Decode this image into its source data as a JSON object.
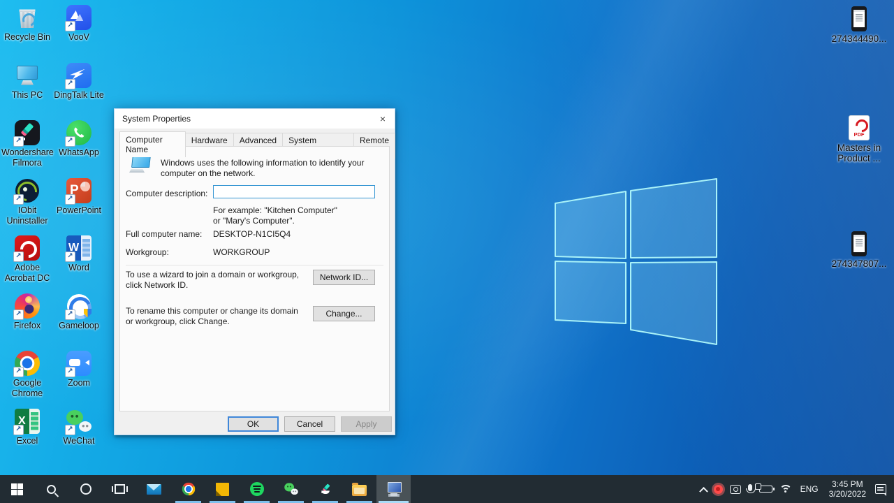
{
  "colors": {
    "wallpaper_left": "#1fbdf0",
    "wallpaper_right": "#0a50a5",
    "taskbar_bg": "#222c33",
    "running_indicator": "#7fc0ec",
    "focus_border": "#3f87d9"
  },
  "desktop": {
    "left_icons": [
      {
        "label": "Recycle Bin",
        "name": "recycle-bin"
      },
      {
        "label": "VooV",
        "name": "voov"
      },
      {
        "label": "This PC",
        "name": "this-pc"
      },
      {
        "label": "DingTalk Lite",
        "name": "dingtalk-lite"
      },
      {
        "label": "Wondershare Filmora",
        "name": "wondershare-filmora"
      },
      {
        "label": "WhatsApp",
        "name": "whatsapp"
      },
      {
        "label": "IObit Uninstaller",
        "name": "iobit-uninstaller"
      },
      {
        "label": "PowerPoint",
        "name": "powerpoint"
      },
      {
        "label": "Adobe Acrobat DC",
        "name": "adobe-acrobat-dc"
      },
      {
        "label": "Word",
        "name": "word"
      },
      {
        "label": "Firefox",
        "name": "firefox"
      },
      {
        "label": "Gameloop",
        "name": "gameloop"
      },
      {
        "label": "Google Chrome",
        "name": "google-chrome"
      },
      {
        "label": "Zoom",
        "name": "zoom"
      },
      {
        "label": "Excel",
        "name": "excel"
      },
      {
        "label": "WeChat",
        "name": "wechat"
      }
    ],
    "right_icons": [
      {
        "label": "274344490...",
        "name": "phone-file-1"
      },
      {
        "label": "Masters in Product ...",
        "name": "pdf-masters-in-product"
      },
      {
        "label": "274347807...",
        "name": "phone-file-2"
      }
    ]
  },
  "dialog": {
    "title": "System Properties",
    "close": "×",
    "tabs": [
      "Computer Name",
      "Hardware",
      "Advanced",
      "System Protection",
      "Remote"
    ],
    "intro": "Windows uses the following information to identify your computer on the network.",
    "computer_description_label": "Computer description:",
    "computer_description_value": "",
    "example_note": "For example: \"Kitchen Computer\" or \"Mary's Computer\".",
    "full_computer_name_label": "Full computer name:",
    "full_computer_name_value": "DESKTOP-N1CI5Q4",
    "workgroup_label": "Workgroup:",
    "workgroup_value": "WORKGROUP",
    "network_id_text": "To use a wizard to join a domain or workgroup, click Network ID.",
    "network_id_button": "Network ID...",
    "change_text": "To rename this computer or change its domain or workgroup, click Change.",
    "change_button": "Change...",
    "ok_button": "OK",
    "cancel_button": "Cancel",
    "apply_button": "Apply"
  },
  "taskbar": {
    "tray": {
      "language": "ENG",
      "time": "3:45 PM",
      "date": "3/20/2022"
    }
  }
}
